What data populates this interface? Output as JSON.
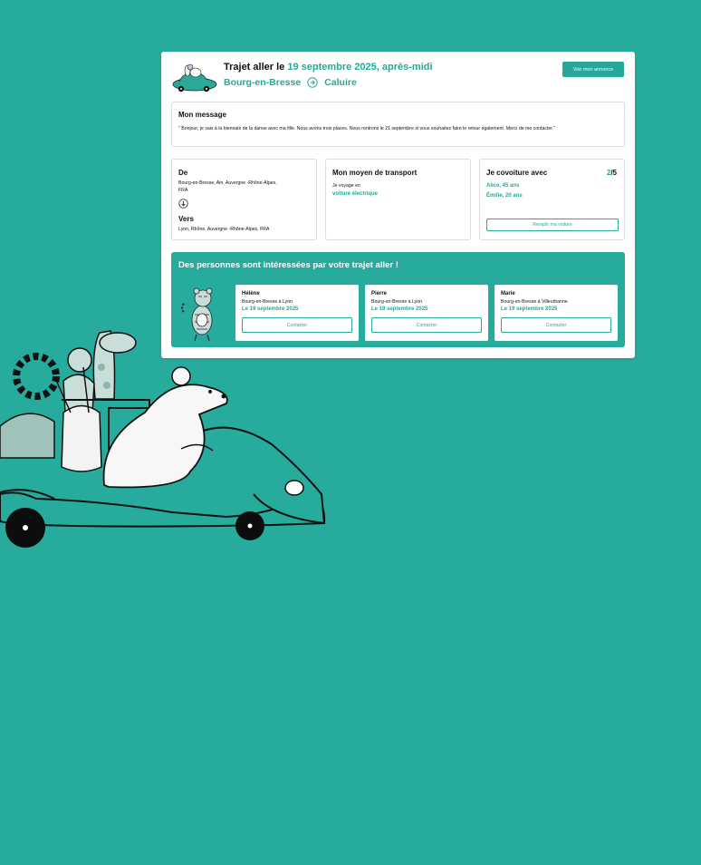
{
  "header": {
    "title_prefix": "Trajet aller le",
    "title_date": "19 septembre 2025, après-midi",
    "from": "Bourg-en-Bresse",
    "to": "Caluire",
    "view_ad_button": "Voir mon annonce"
  },
  "message": {
    "heading": "Mon message",
    "text": "\" Bonjour, je vais à la biennale de la danse avec ma fille. Nous avons trois places. Nous rentrons le 21 septembre si vous souhaitez faire le retour également. Merci de me contacter.\""
  },
  "route": {
    "from_label": "De",
    "from_value": "Bourg-en-Bresse, Ain, Auvergne -Rhône-Alpes, FRA",
    "to_label": "Vers",
    "to_value": "Lyon, Rhône, Auvergne -Rhône-Alpes, FRA"
  },
  "transport": {
    "heading": "Mon moyen de transport",
    "line1": "Je voyage en",
    "mode": "voiture électrique"
  },
  "carpool": {
    "heading": "Je covoiture avec",
    "count": "2",
    "total": "/5",
    "passengers": [
      "Alice, 45 ans",
      "Émilie, 20 ans"
    ],
    "fill_button": "Remplir ma voiture"
  },
  "interested": {
    "heading": "Des personnes sont intéressées par votre trajet aller !",
    "people": [
      {
        "name": "Hélène",
        "route": "Bourg-en-Bresse à Lyon",
        "date": "Le 19 septembre 2025",
        "button": "Contacter"
      },
      {
        "name": "Pierre",
        "route": "Bourg-en-Bresse à Lyon",
        "date": "Le 19 septembre 2025",
        "button": "Contacter"
      },
      {
        "name": "Marie",
        "route": "Bourg-en-Bresse à Villeurbanne",
        "date": "Le 19 septembre 2025",
        "button": "Contacter"
      }
    ]
  },
  "colors": {
    "background": "#26ab9d",
    "accent": "#25a898",
    "card": "#ffffff"
  },
  "icons": [
    "car-animals-thumbnail",
    "arrow-right-circle-icon",
    "arrow-down-circle-icon",
    "tiger-guitar-illustration",
    "animals-car-illustration"
  ]
}
